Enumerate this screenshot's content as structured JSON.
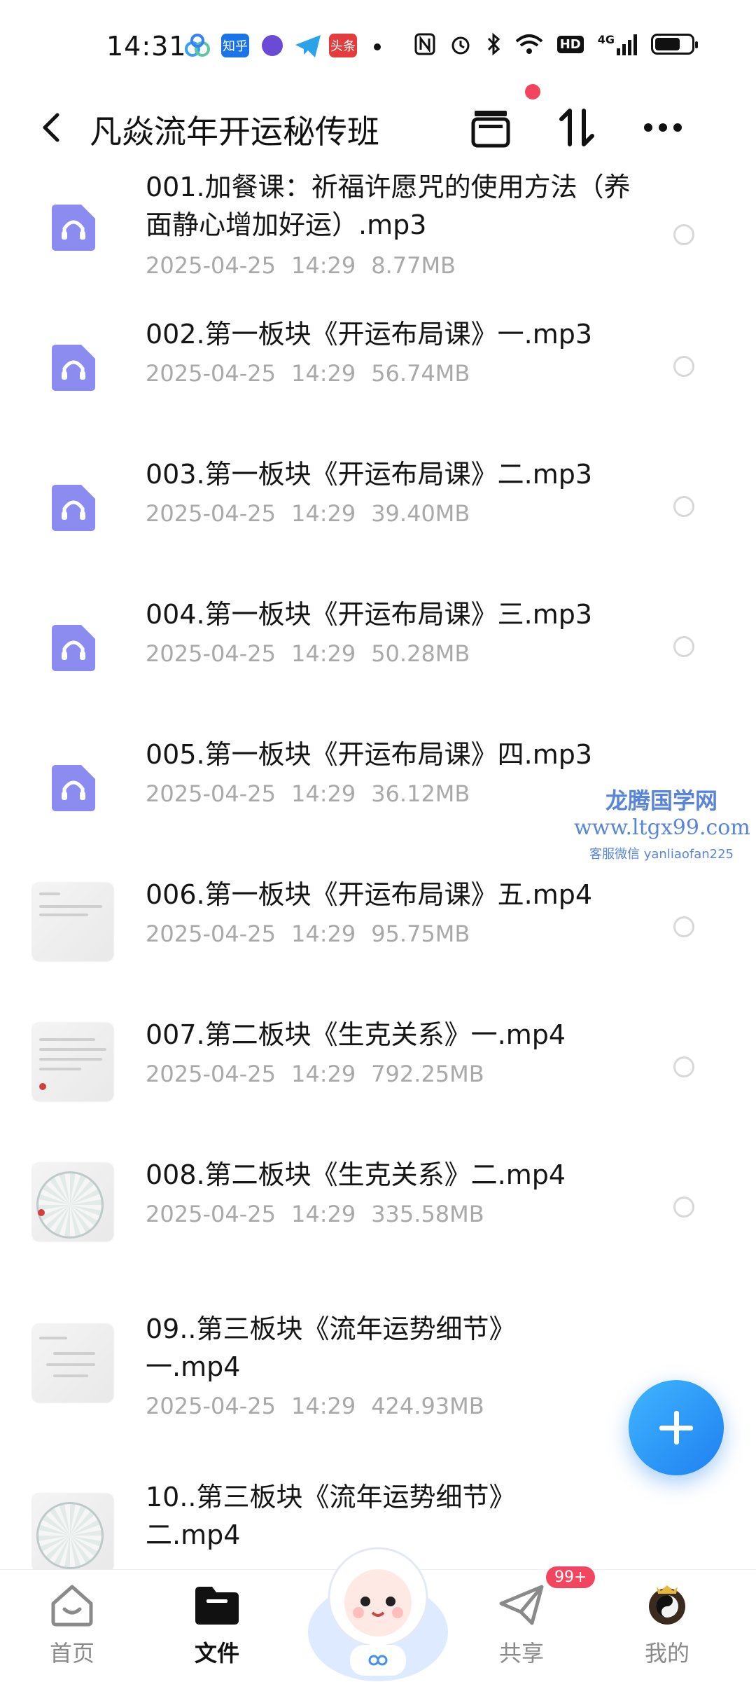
{
  "status_bar": {
    "time": "14:31",
    "apps": [
      "知乎",
      "头条"
    ],
    "network": "4G",
    "hd": "HD"
  },
  "header": {
    "title": "凡焱流年开运秘传班"
  },
  "files": [
    {
      "name": "001.加餐课：祈福许愿咒的使用方法（养面静心增加好运）.mp3",
      "date": "2025-04-25",
      "time": "14:29",
      "size": "8.77MB",
      "type": "audio"
    },
    {
      "name": "002.第一板块《开运布局课》一.mp3",
      "date": "2025-04-25",
      "time": "14:29",
      "size": "56.74MB",
      "type": "audio"
    },
    {
      "name": "003.第一板块《开运布局课》二.mp3",
      "date": "2025-04-25",
      "time": "14:29",
      "size": "39.40MB",
      "type": "audio"
    },
    {
      "name": "004.第一板块《开运布局课》三.mp3",
      "date": "2025-04-25",
      "time": "14:29",
      "size": "50.28MB",
      "type": "audio"
    },
    {
      "name": "005.第一板块《开运布局课》四.mp3",
      "date": "2025-04-25",
      "time": "14:29",
      "size": "36.12MB",
      "type": "audio"
    },
    {
      "name": "006.第一板块《开运布局课》五.mp4",
      "date": "2025-04-25",
      "time": "14:29",
      "size": "95.75MB",
      "type": "video"
    },
    {
      "name": "007.第二板块《生克关系》一.mp4",
      "date": "2025-04-25",
      "time": "14:29",
      "size": "792.25MB",
      "type": "video"
    },
    {
      "name": "008.第二板块《生克关系》二.mp4",
      "date": "2025-04-25",
      "time": "14:29",
      "size": "335.58MB",
      "type": "video"
    },
    {
      "name": "09..第三板块《流年运势细节》一.mp4",
      "date": "2025-04-25",
      "time": "14:29",
      "size": "424.93MB",
      "type": "video"
    },
    {
      "name": "10..第三板块《流年运势细节》二.mp4",
      "date": "",
      "time": "",
      "size": "",
      "type": "video"
    }
  ],
  "watermark": {
    "line1": "龙腾国学网",
    "line2": "www.ltgx99.com",
    "line3": "客服微信 yanliaofan225"
  },
  "tabbar": {
    "home": "首页",
    "files": "文件",
    "share": "共享",
    "mine": "我的",
    "share_badge": "99+"
  },
  "colors": {
    "accent": "#1f80f0",
    "audio_icon": "#8c8cf0",
    "badge": "#f14560"
  }
}
